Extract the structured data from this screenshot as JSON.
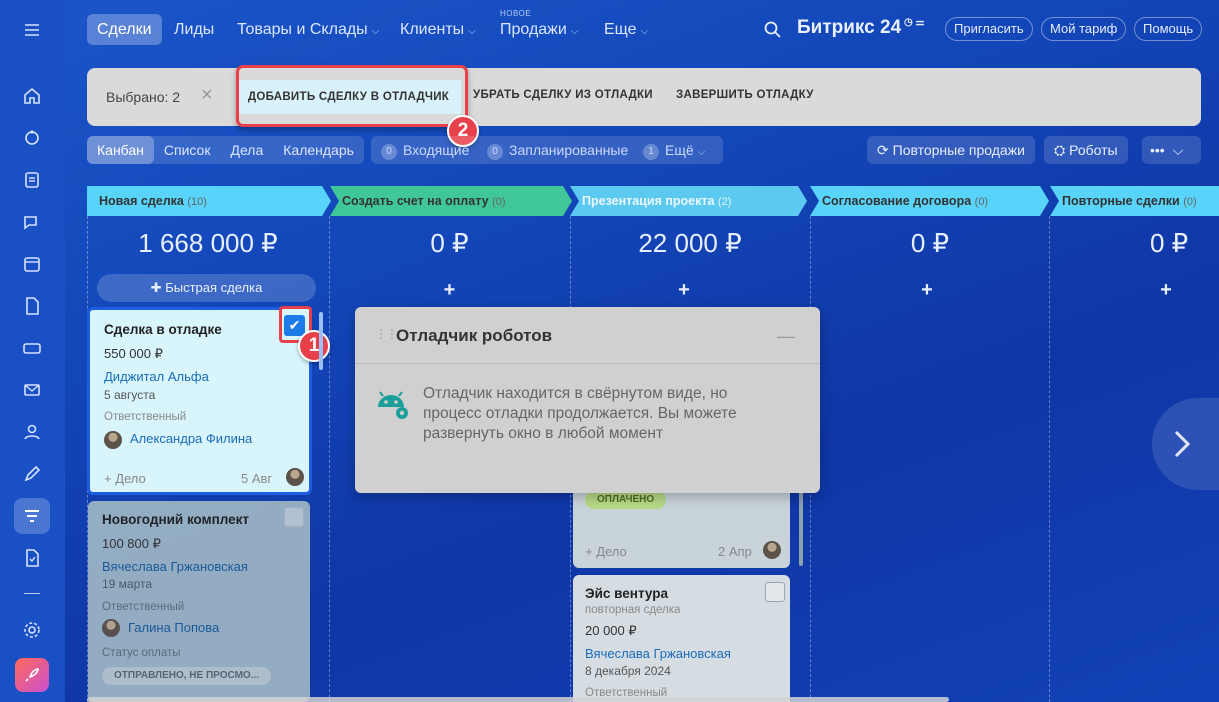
{
  "topnav": {
    "items": [
      {
        "label": "Сделки"
      },
      {
        "label": "Лиды"
      },
      {
        "label": "Товары и Склады"
      },
      {
        "label": "Клиенты"
      },
      {
        "label": "Продажи",
        "tag": "НОВОЕ"
      },
      {
        "label": "Еще"
      }
    ],
    "brand": "Битрикс 24",
    "invite": "Пригласить",
    "tariff": "Мой тариф",
    "help": "Помощь"
  },
  "selection_bar": {
    "selected": "Выбрано: 2",
    "add_debug": "ДОБАВИТЬ СДЕЛКУ В ОТЛАДЧИК",
    "remove_debug": "УБРАТЬ СДЕЛКУ ИЗ ОТЛАДКИ",
    "finish_debug": "ЗАВЕРШИТЬ ОТЛАДКУ"
  },
  "annotations": {
    "step1": "1",
    "step2": "2"
  },
  "views": {
    "tabs": [
      "Канбан",
      "Список",
      "Дела",
      "Календарь"
    ],
    "counters": [
      {
        "n": "0",
        "label": "Входящие"
      },
      {
        "n": "0",
        "label": "Запланированные"
      },
      {
        "n": "1",
        "label": "Ещё"
      }
    ],
    "repeat_sales": "Повторные продажи",
    "robots": "Роботы"
  },
  "columns": [
    {
      "name": "Новая сделка",
      "count": "(10)",
      "sum": "1 668 000 ₽",
      "color": "#2fc6f6"
    },
    {
      "name": "Создать счет на оплату",
      "count": "(0)",
      "sum": "0 ₽",
      "color": "#2fbd8a"
    },
    {
      "name": "Презентация проекта",
      "count": "(2)",
      "sum": "22 000 ₽",
      "color": "#35b6e8"
    },
    {
      "name": "Согласование договора",
      "count": "(0)",
      "sum": "0 ₽",
      "color": "#2fc6f6"
    },
    {
      "name": "Повторные сделки",
      "count": "(0)",
      "sum": "0 ₽",
      "color": "#2fc6f6"
    }
  ],
  "quick_deal": "Быстрая сделка",
  "cards": {
    "c1": {
      "title": "Сделка в отладке",
      "sum": "550 000 ₽",
      "company": "Диджитал Альфа",
      "date": "5 августа",
      "resp_label": "Ответственный",
      "resp": "Александра Филина",
      "add": "+ Дело",
      "short_date": "5 Авг"
    },
    "c2": {
      "title": "Новогодний комплект",
      "sum": "100 800 ₽",
      "company": "Вячеслава Гржановская",
      "date": "19 марта",
      "resp_label": "Ответственный",
      "resp": "Галина Попова",
      "pay_label": "Статус оплаты",
      "pay_status": "ОТПРАВЛЕНО, НЕ ПРОСМО..."
    },
    "c3": {
      "status": "ОПЛАЧЕНО",
      "add": "+ Дело",
      "short_date": "2 Апр"
    },
    "c4": {
      "title": "Эйс вентура",
      "subtitle": "повторная сделка",
      "sum": "20 000 ₽",
      "company": "Вячеслава Гржановская",
      "date": "8 декабря 2024",
      "resp_label": "Ответственный"
    }
  },
  "debugger": {
    "title": "Отладчик роботов",
    "text": "Отладчик находится в свёрнутом виде, но процесс отладки продолжается. Вы можете развернуть окно в любой момент"
  }
}
